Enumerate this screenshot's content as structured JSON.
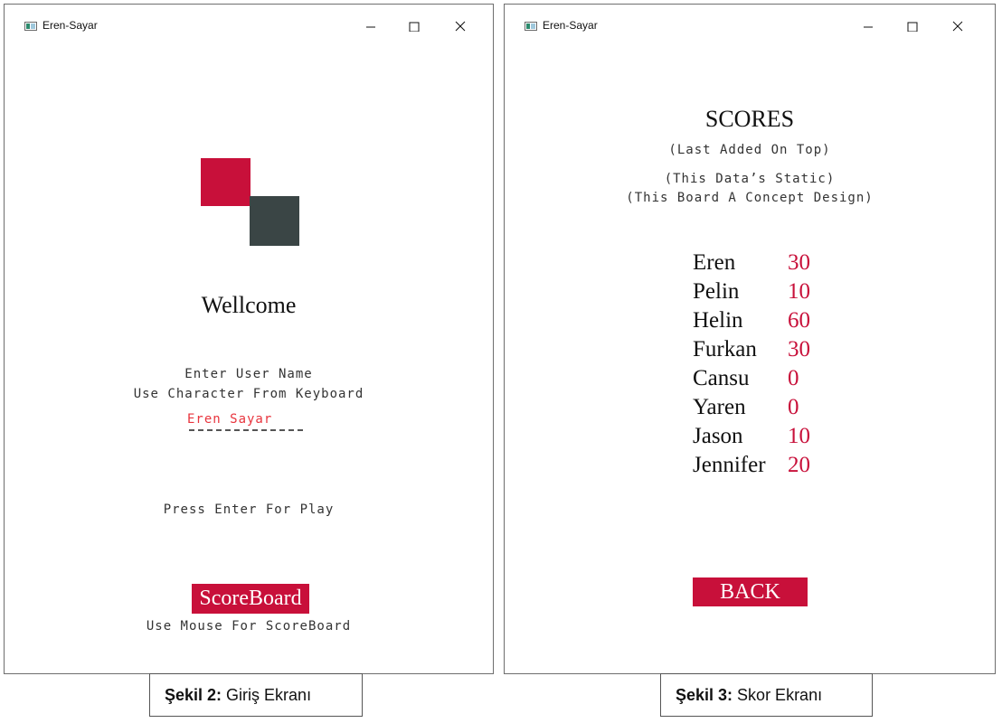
{
  "colors": {
    "accent": "#c8103a",
    "dark": "#3a4545",
    "input_text": "#e8343d"
  },
  "login_window": {
    "title": "Eren-Sayar",
    "title_icon": "app-window-icon",
    "controls": {
      "minimize": "minimize-icon",
      "maximize": "maximize-icon",
      "close": "close-icon"
    },
    "heading": "Wellcome",
    "instruction_line1": "Enter User Name",
    "instruction_line2": "Use Character From Keyboard",
    "username_value": "Eren Sayar",
    "press_enter": "Press Enter For Play",
    "scoreboard_button": "ScoreBoard",
    "mouse_hint": "Use Mouse For ScoreBoard"
  },
  "score_window": {
    "title": "Eren-Sayar",
    "title_icon": "app-window-icon",
    "controls": {
      "minimize": "minimize-icon",
      "maximize": "maximize-icon",
      "close": "close-icon"
    },
    "heading": "SCORES",
    "subtitle": "(Last Added On Top)",
    "note_line1": "(This Data’s Static)",
    "note_line2": "(This Board A Concept Design)",
    "scores": [
      {
        "name": "Eren",
        "score": "30"
      },
      {
        "name": "Pelin",
        "score": "10"
      },
      {
        "name": "Helin",
        "score": "60"
      },
      {
        "name": "Furkan",
        "score": "30"
      },
      {
        "name": "Cansu",
        "score": "0"
      },
      {
        "name": "Yaren",
        "score": "0"
      },
      {
        "name": "Jason",
        "score": "10"
      },
      {
        "name": "Jennifer",
        "score": "20"
      }
    ],
    "back_button": "BACK"
  },
  "captions": {
    "left": {
      "bold": "Şekil 2:",
      "text": " Giriş Ekranı"
    },
    "right": {
      "bold": "Şekil 3:",
      "text": " Skor Ekranı"
    }
  }
}
